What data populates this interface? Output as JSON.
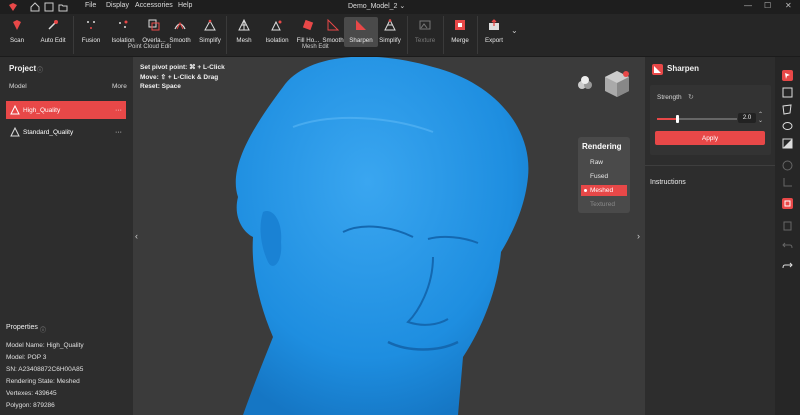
{
  "window": {
    "title": "Demo_Model_2",
    "menus": [
      "File",
      "Display",
      "Accessories",
      "Help"
    ]
  },
  "toolbar": {
    "tools": [
      {
        "label": "Scan",
        "icon": "scan-icon"
      },
      {
        "label": "Auto Edit",
        "icon": "auto-edit-icon"
      },
      {
        "label": "Fusion",
        "icon": "fusion-icon"
      },
      {
        "label": "Isolation",
        "icon": "isolation-icon"
      },
      {
        "label": "Overla...",
        "icon": "overlap-icon"
      },
      {
        "label": "Smooth",
        "icon": "smooth-icon"
      },
      {
        "label": "Simplify",
        "icon": "simplify-icon"
      },
      {
        "label": "Mesh",
        "icon": "mesh-icon"
      },
      {
        "label": "Isolation",
        "icon": "isolation-icon"
      },
      {
        "label": "Fill Ho...",
        "icon": "fill-holes-icon"
      },
      {
        "label": "Smooth",
        "icon": "smooth-icon"
      },
      {
        "label": "Sharpen",
        "icon": "sharpen-icon"
      },
      {
        "label": "Simplify",
        "icon": "simplify-icon"
      },
      {
        "label": "Texture",
        "icon": "texture-icon"
      },
      {
        "label": "Merge",
        "icon": "merge-icon"
      },
      {
        "label": "Export",
        "icon": "export-icon"
      }
    ],
    "groups": {
      "point_cloud": "Point Cloud Edit",
      "mesh": "Mesh Edit"
    }
  },
  "project": {
    "title": "Project",
    "model_label": "Model",
    "more_label": "More",
    "models": [
      {
        "name": "High_Quality",
        "more": "···"
      },
      {
        "name": "Standard_Quality",
        "more": "···"
      }
    ]
  },
  "properties": {
    "title": "Properties",
    "rows": [
      "Model Name:  High_Quality",
      "Model:  POP 3",
      "SN:  A23408872C6H00A85",
      "Rendering State:  Meshed",
      "Vertexes:  439645",
      "Polygon:  879286"
    ]
  },
  "viewport": {
    "hints": [
      "Set pivot point: ⌘ + L-Click",
      "Move: ⇧ + L-Click & Drag",
      "Reset: Space"
    ],
    "rendering": {
      "title": "Rendering",
      "options": [
        "Raw",
        "Fused",
        "Meshed",
        "Textured"
      ],
      "selected": "Meshed"
    },
    "mesh_color": "#1e90e6"
  },
  "sharpen": {
    "title": "Sharpen",
    "strength_label": "Strength",
    "strength_value": "2.0",
    "strength_fraction": 0.25,
    "apply_label": "Apply",
    "instructions_label": "Instructions"
  },
  "colors": {
    "accent": "#e84848",
    "panel": "#2d2d2d",
    "viewport": "#3b3b3b"
  }
}
